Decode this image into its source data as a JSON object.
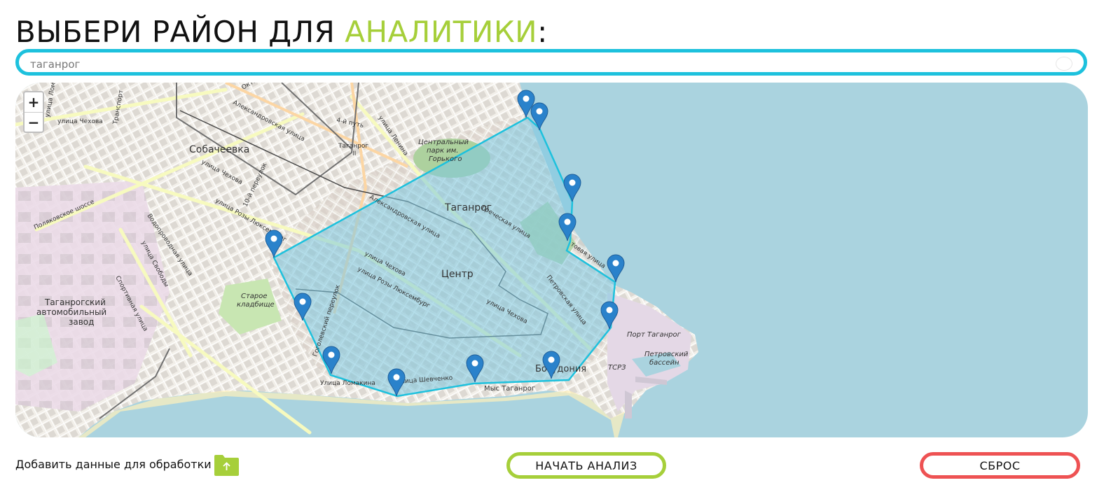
{
  "header": {
    "title_main": "ВЫБЕРИ РАЙОН ДЛЯ ",
    "title_accent": "АНАЛИТИКИ",
    "title_end": ":"
  },
  "search": {
    "value": "таганрог",
    "placeholder": "таганрог",
    "icon": "search-icon"
  },
  "map": {
    "zoom_in": "+",
    "zoom_out": "−",
    "labels": {
      "city": "Таганрог",
      "center": "Центр",
      "sobacheevka": "Собачеевка",
      "bogudonia": "Богудония",
      "cape": "Мыс Таганрог",
      "port": "Порт Таганрог",
      "basin_1": "Петровский",
      "basin_2": "бассейн",
      "tsrz": "ТСРЗ",
      "cemetery_1": "Старое",
      "cemetery_2": "кладбище",
      "park_1": "Центральный",
      "park_2": "парк им.",
      "park_3": "Горького",
      "plant_1": "Таганрогский",
      "plant_2": "автомобильный",
      "plant_3": "завод",
      "station_1": "Таганрог",
      "station_2": "II",
      "street_chekhova_1": "улица Чехова",
      "street_chekhova_2": "улица Чехова",
      "street_chekhova_3": "улица Чехова",
      "street_chekhova_4": "улица Чехова",
      "street_alexandrovskaya_1": "Александровская улица",
      "street_alexandrovskaya_2": "Александровская улица",
      "street_roza_1": "улица Розы Люксембург",
      "street_roza_2": "улица Розы Люксембург",
      "street_grecheskaya": "Греческая улица",
      "street_petrovskaya": "Петровская улица",
      "street_lenina": "улица Ленина",
      "street_oktyabrskaya": "Октябрьская улица",
      "street_vodoprovodnaya": "Водопроводная улица",
      "street_svobody": "улица Свободы",
      "street_sportivnaya": "Спортивная улица",
      "street_polyakovskoe": "Поляковское шоссе",
      "street_lomakina": "Улица Ломакина",
      "street_shevchenko": "улица Шевченко",
      "street_gogolevsky": "Гоголевский переулок",
      "street_pereulok_10": "10-й переулок",
      "street_transport": "Транспорт",
      "street_primorskaya": "товая улица",
      "street_lom": "улица Ломо",
      "street_abutry": "4-й путь"
    },
    "marker_count": 12,
    "polygon_color": "#1dc1dd"
  },
  "footer": {
    "add_data_label": "Добавить данные для обработки",
    "folder_icon": "folder-upload-icon",
    "start_button": "НАЧАТЬ АНАЛИЗ",
    "reset_button": "СБРОС"
  },
  "colors": {
    "accent_green": "#a6cf3a",
    "accent_cyan": "#1dc1dd",
    "reset_red": "#ee5253",
    "sea": "#aad3df"
  }
}
